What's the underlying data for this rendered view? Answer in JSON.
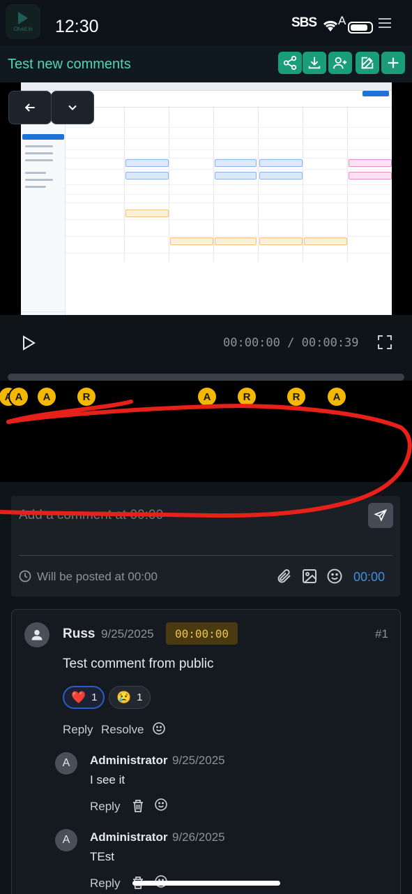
{
  "status_bar": {
    "time": "12:30",
    "carrier_badge": "SBS",
    "a_glyph": "A",
    "app_logo_text": "Otvid.io"
  },
  "header": {
    "title": "Test new comments",
    "buttons": [
      "share-icon",
      "download-icon",
      "add-user-icon",
      "edit-icon",
      "plus-icon"
    ]
  },
  "video_nav": {
    "prev_icon": "arrow-left-icon",
    "next_icon": "chevron-down-icon"
  },
  "player": {
    "current_time": "00:00:00",
    "separator": "/",
    "duration": "00:00:39"
  },
  "markers": [
    "A",
    "A",
    "A",
    "R",
    "A",
    "R",
    "R",
    "A"
  ],
  "composer": {
    "placeholder": "Add a comment at 00:00",
    "post_time_label": "Will be posted at 00:00",
    "time_chip": "00:00"
  },
  "comment": {
    "author": "Russ",
    "date": "9/25/2025",
    "timestamp": "00:00:00",
    "number": "#1",
    "text": "Test comment from public",
    "reactions": [
      {
        "emoji": "❤️",
        "count": "1"
      },
      {
        "emoji": "😢",
        "count": "1"
      }
    ],
    "reply_label": "Reply",
    "resolve_label": "Resolve",
    "replies": [
      {
        "initial": "A",
        "author": "Administrator",
        "date": "9/25/2025",
        "text": "I see it",
        "reply_label": "Reply"
      },
      {
        "initial": "A",
        "author": "Administrator",
        "date": "9/26/2025",
        "text": "TEst",
        "reply_label": "Reply"
      }
    ]
  },
  "colors": {
    "accent": "#1a9d79",
    "title": "#4fd6b4",
    "marker": "#f5b800",
    "link": "#3d8fe0",
    "annotation": "#e8201a"
  }
}
